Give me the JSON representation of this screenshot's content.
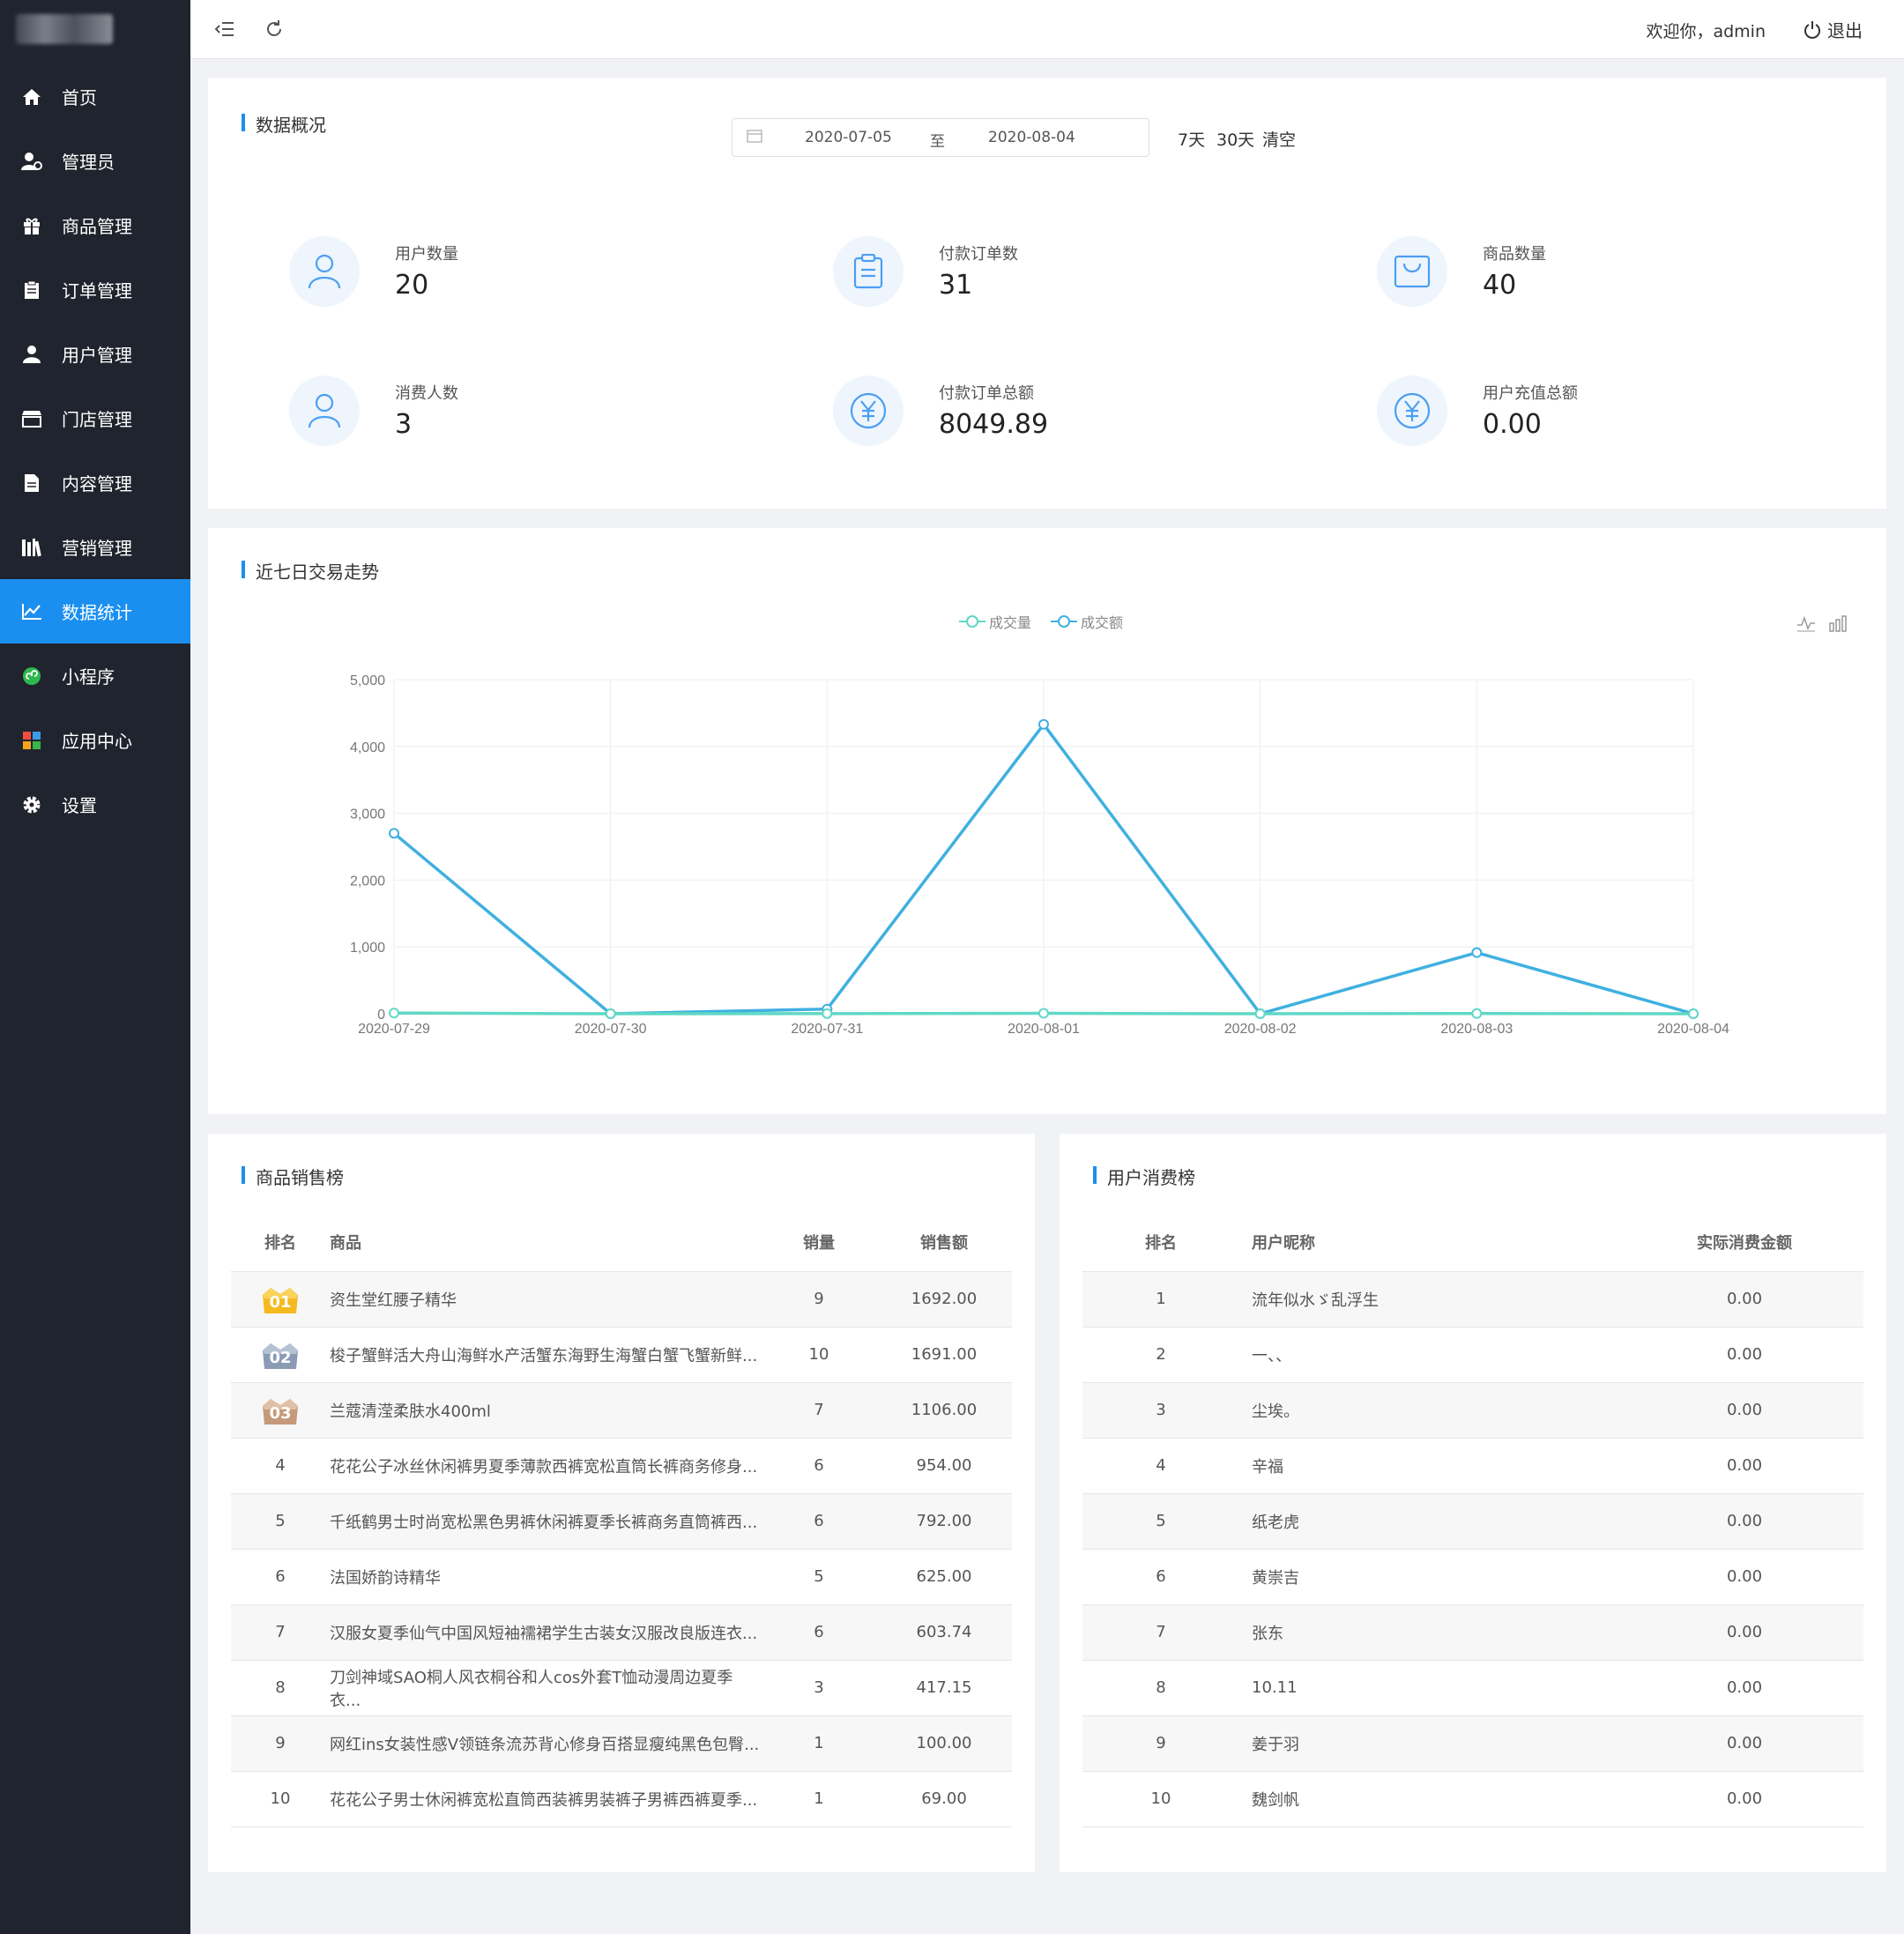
{
  "nav": {
    "items": [
      {
        "label": "首页",
        "icon": "home-icon"
      },
      {
        "label": "管理员",
        "icon": "admin-icon"
      },
      {
        "label": "商品管理",
        "icon": "gift-icon"
      },
      {
        "label": "订单管理",
        "icon": "clipboard-icon"
      },
      {
        "label": "用户管理",
        "icon": "user-icon"
      },
      {
        "label": "门店管理",
        "icon": "store-icon"
      },
      {
        "label": "内容管理",
        "icon": "document-icon"
      },
      {
        "label": "营销管理",
        "icon": "books-icon"
      },
      {
        "label": "数据统计",
        "icon": "chart-icon",
        "active": true
      },
      {
        "label": "小程序",
        "icon": "miniprogram-icon"
      },
      {
        "label": "应用中心",
        "icon": "apps-icon"
      },
      {
        "label": "设置",
        "icon": "gear-icon"
      }
    ]
  },
  "topbar": {
    "welcome": "欢迎你，admin",
    "logout": "退出"
  },
  "overview": {
    "title": "数据概况",
    "date_start": "2020-07-05",
    "date_sep": "至",
    "date_end": "2020-08-04",
    "quick": [
      "7天",
      "30天",
      "清空"
    ],
    "stats": [
      {
        "label": "用户数量",
        "value": "20",
        "icon": "user-icon"
      },
      {
        "label": "付款订单数",
        "value": "31",
        "icon": "clipboard-icon"
      },
      {
        "label": "商品数量",
        "value": "40",
        "icon": "bag-icon"
      },
      {
        "label": "消费人数",
        "value": "3",
        "icon": "user-icon"
      },
      {
        "label": "付款订单总额",
        "value": "8049.89",
        "icon": "yen-icon"
      },
      {
        "label": "用户充值总额",
        "value": "0.00",
        "icon": "yen-icon"
      }
    ]
  },
  "trend": {
    "title": "近七日交易走势"
  },
  "chart_data": {
    "type": "line",
    "categories": [
      "2020-07-29",
      "2020-07-30",
      "2020-07-31",
      "2020-08-01",
      "2020-08-02",
      "2020-08-03",
      "2020-08-04"
    ],
    "series": [
      {
        "name": "成交量",
        "values": [
          10,
          0,
          2,
          6,
          0,
          3,
          0
        ],
        "color": "#5fd8c4"
      },
      {
        "name": "成交额",
        "values": [
          2700,
          0,
          70,
          4330,
          0,
          915,
          0
        ],
        "color": "#3fb0e0"
      }
    ],
    "ylim": [
      0,
      5000
    ],
    "yticks": [
      "0",
      "1,000",
      "2,000",
      "3,000",
      "4,000",
      "5,000"
    ],
    "legend": "top-center",
    "grid": true
  },
  "sales": {
    "title": "商品销售榜",
    "headers": [
      "排名",
      "商品",
      "销量",
      "销售额"
    ],
    "rows": [
      {
        "rank": "01",
        "name": "资生堂红腰子精华",
        "qty": "9",
        "amount": "1692.00"
      },
      {
        "rank": "02",
        "name": "梭子蟹鲜活大舟山海鲜水产活蟹东海野生海蟹白蟹飞蟹新鲜...",
        "qty": "10",
        "amount": "1691.00"
      },
      {
        "rank": "03",
        "name": "兰蔻清滢柔肤水400ml",
        "qty": "7",
        "amount": "1106.00"
      },
      {
        "rank": "4",
        "name": "花花公子冰丝休闲裤男夏季薄款西裤宽松直筒长裤商务修身...",
        "qty": "6",
        "amount": "954.00"
      },
      {
        "rank": "5",
        "name": "千纸鹤男士时尚宽松黑色男裤休闲裤夏季长裤商务直筒裤西...",
        "qty": "6",
        "amount": "792.00"
      },
      {
        "rank": "6",
        "name": "法国娇韵诗精华",
        "qty": "5",
        "amount": "625.00"
      },
      {
        "rank": "7",
        "name": "汉服女夏季仙气中国风短袖襦裙学生古装女汉服改良版连衣...",
        "qty": "6",
        "amount": "603.74"
      },
      {
        "rank": "8",
        "name": "刀剑神域SAO桐人风衣桐谷和人cos外套T恤动漫周边夏季衣...",
        "qty": "3",
        "amount": "417.15"
      },
      {
        "rank": "9",
        "name": "网红ins女装性感V领链条流苏背心修身百搭显瘦纯黑色包臀...",
        "qty": "1",
        "amount": "100.00"
      },
      {
        "rank": "10",
        "name": "花花公子男士休闲裤宽松直筒西装裤男装裤子男裤西裤夏季...",
        "qty": "1",
        "amount": "69.00"
      }
    ]
  },
  "users": {
    "title": "用户消费榜",
    "headers": [
      "排名",
      "用户昵称",
      "实际消费金额"
    ],
    "rows": [
      {
        "rank": "1",
        "name": "流年似水ゞ乱浮生",
        "amount": "0.00"
      },
      {
        "rank": "2",
        "name": "一、、",
        "amount": "0.00"
      },
      {
        "rank": "3",
        "name": "尘埃。",
        "amount": "0.00"
      },
      {
        "rank": "4",
        "name": "辛福",
        "amount": "0.00"
      },
      {
        "rank": "5",
        "name": "纸老虎",
        "amount": "0.00"
      },
      {
        "rank": "6",
        "name": "黄崇吉",
        "amount": "0.00"
      },
      {
        "rank": "7",
        "name": "张东",
        "amount": "0.00"
      },
      {
        "rank": "8",
        "name": "10.11",
        "amount": "0.00"
      },
      {
        "rank": "9",
        "name": "姜于羽",
        "amount": "0.00"
      },
      {
        "rank": "10",
        "name": "魏剑帆",
        "amount": "0.00"
      }
    ]
  }
}
